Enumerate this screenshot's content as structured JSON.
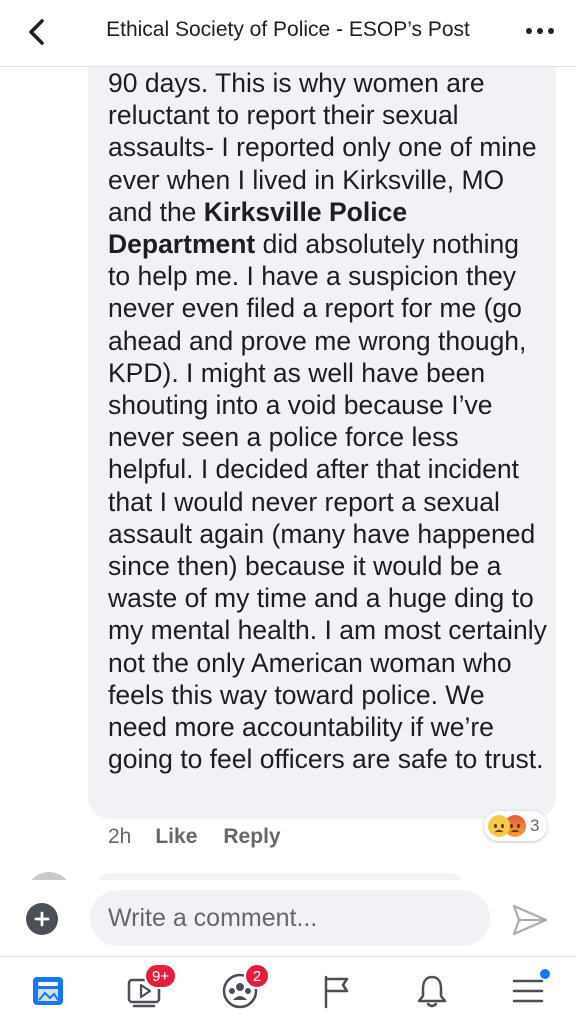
{
  "header": {
    "title": "Ethical Society of Police - ESOP’s Post",
    "back_icon": "chevron-left-icon",
    "more_icon": "more-dots-icon"
  },
  "comment": {
    "lines_part1": "90 days. This is why women are reluctant to report their sexual assaults- I reported only one of mine ever when I lived in Kirksville, MO and the ",
    "bold_mention": "Kirksville Police Department",
    "lines_part2": " did absolutely nothing to help me. I have a suspicion they never even filed a report for me (go ahead and prove me wrong though, KPD). I might as well have been shouting into a void because I’ve never seen a police force less helpful. I decided after that incident that I would never report a sexual assault again (many have happened since then) because it would be a waste of my time and a huge ding to my mental health. I am most certainly not the only American woman who feels this way toward police. We need more accountability if we’re going to feel officers are safe to trust.",
    "time": "2h",
    "like_label": "Like",
    "reply_label": "Reply",
    "reactions": {
      "icons": [
        "sad-emoji-icon",
        "angry-emoji-icon"
      ],
      "count": "3"
    }
  },
  "composer": {
    "placeholder": "Write a comment...",
    "plus_icon": "plus-icon",
    "send_icon": "send-icon"
  },
  "tabbar": {
    "tabs": [
      {
        "name": "news-feed",
        "icon": "news-feed-icon",
        "badge": ""
      },
      {
        "name": "watch",
        "icon": "watch-video-icon",
        "badge": "9+"
      },
      {
        "name": "groups",
        "icon": "groups-icon",
        "badge": "2"
      },
      {
        "name": "pages",
        "icon": "flag-icon",
        "badge": ""
      },
      {
        "name": "notifications",
        "icon": "bell-icon",
        "badge": ""
      },
      {
        "name": "menu",
        "icon": "menu-icon",
        "badge": ""
      }
    ]
  },
  "colors": {
    "bubble": "#f0f2f5",
    "badge": "#e41e3f",
    "accent": "#1877f2",
    "text": "#1c1e21",
    "secondary_text": "#65676b"
  }
}
